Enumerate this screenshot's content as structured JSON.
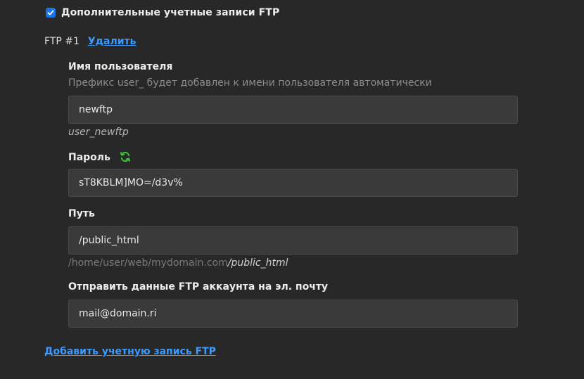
{
  "extra_ftp": {
    "checked": true,
    "label": "Дополнительные учетные записи FTP"
  },
  "ftp_account": {
    "number_label": "FTP #1",
    "delete_label": "Удалить",
    "username": {
      "label": "Имя пользователя",
      "hint": "Префикс user_ будет добавлен к имени пользователя автоматически",
      "value": "newftp",
      "preview": "user_newftp"
    },
    "password": {
      "label": "Пароль",
      "value": "sT8KBLM]MO=/d3v%",
      "generate_icon": "refresh-icon"
    },
    "path": {
      "label": "Путь",
      "value": "/public_html",
      "preview_base": "/home/user/web/mydomain.com",
      "preview_tail": "/public_html"
    },
    "email": {
      "label": "Отправить данные FTP аккаунта на эл. почту",
      "value": "mail@domain.ri"
    }
  },
  "add_account_label": "Добавить учетную запись FTP",
  "colors": {
    "background": "#282828",
    "input_bg": "#3a3a3a",
    "link": "#3d9bff",
    "checkbox": "#1a73e8",
    "refresh_icon": "#3cc43c"
  }
}
